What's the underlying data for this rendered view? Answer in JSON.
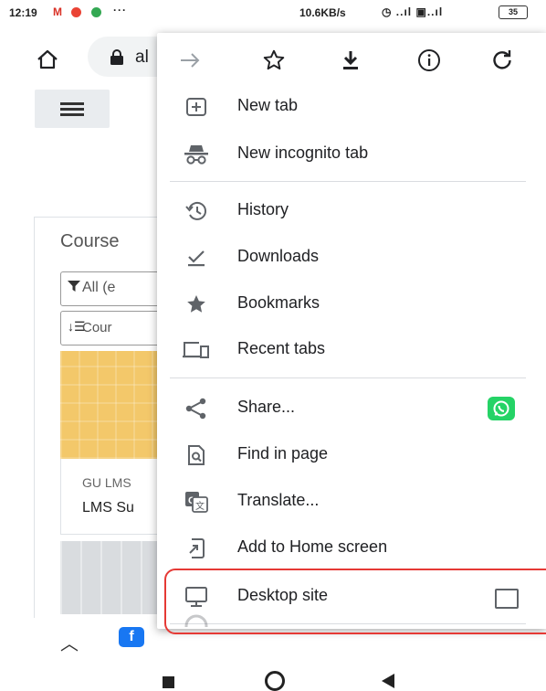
{
  "status_bar": {
    "time": "12:19",
    "gmail": "M",
    "dots": "···",
    "speed": "10.6KB/s",
    "signals": "◷ ..ıl ▣..ıl",
    "battery": "35"
  },
  "toolbar": {
    "url_text": "al"
  },
  "page": {
    "course_heading": "Course",
    "filter_label": "All (e",
    "sort_label": "Cour",
    "tile_category": "GU LMS",
    "tile_title": "LMS Su",
    "fb_label": "f"
  },
  "menu": {
    "items": [
      {
        "label": "New tab",
        "icon": "new-tab-icon"
      },
      {
        "label": "New incognito tab",
        "icon": "incognito-icon"
      },
      {
        "label": "History",
        "icon": "history-icon"
      },
      {
        "label": "Downloads",
        "icon": "downloads-icon"
      },
      {
        "label": "Bookmarks",
        "icon": "bookmarks-icon"
      },
      {
        "label": "Recent tabs",
        "icon": "recent-tabs-icon"
      },
      {
        "label": "Share...",
        "icon": "share-icon"
      },
      {
        "label": "Find in page",
        "icon": "find-in-page-icon"
      },
      {
        "label": "Translate...",
        "icon": "translate-icon"
      },
      {
        "label": "Add to Home screen",
        "icon": "add-to-home-icon"
      },
      {
        "label": "Desktop site",
        "icon": "desktop-icon"
      }
    ],
    "desktop_site_checked": false
  },
  "colors": {
    "highlight": "#e53935",
    "whatsapp": "#25d366",
    "facebook": "#1877f2"
  }
}
